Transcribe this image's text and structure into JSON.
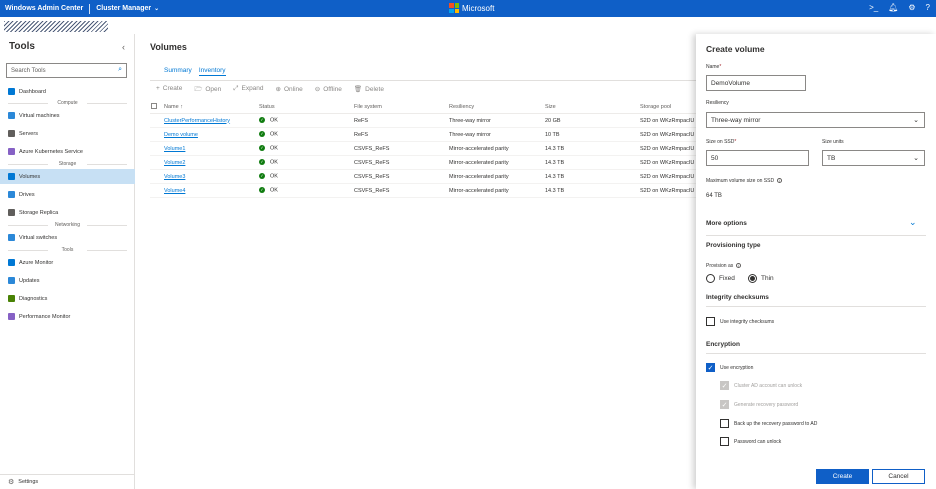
{
  "topbar": {
    "app_title": "Windows Admin Center",
    "context": "Cluster Manager",
    "brand": "Microsoft"
  },
  "colors": {
    "accent": "#0f5fc7",
    "link": "#0078d4",
    "ok": "#107c10",
    "selected": "#c7e0f4"
  },
  "sidebar": {
    "title": "Tools",
    "search_placeholder": "Search Tools",
    "items": {
      "dashboard": "Dashboard",
      "compute_group": "Compute",
      "virtual_machines": "Virtual machines",
      "servers": "Servers",
      "aks": "Azure Kubernetes Service",
      "storage_group": "Storage",
      "volumes": "Volumes",
      "drives": "Drives",
      "storage_replica": "Storage Replica",
      "networking_group": "Networking",
      "virtual_switches": "Virtual switches",
      "tools_group": "Tools",
      "azure_monitor": "Azure Monitor",
      "updates": "Updates",
      "diagnostics": "Diagnostics",
      "performance_monitor": "Performance Monitor"
    },
    "settings": "Settings"
  },
  "main": {
    "title": "Volumes",
    "tabs": [
      "Summary",
      "Inventory"
    ],
    "toolbar": [
      "Create",
      "Open",
      "Expand",
      "Online",
      "Offline",
      "Delete"
    ],
    "columns": [
      "Name",
      "Status",
      "File system",
      "Resiliency",
      "Size",
      "Storage pool"
    ],
    "name_sort_indicator": "↑",
    "rows": [
      {
        "name": "ClusterPerformanceHistory",
        "status": "OK",
        "fs": "ReFS",
        "resiliency": "Three-way mirror",
        "size": "20 GB",
        "pool": "S2D on WKzRmpacIU"
      },
      {
        "name": "Demo volume",
        "status": "OK",
        "fs": "ReFS",
        "resiliency": "Three-way mirror",
        "size": "10 TB",
        "pool": "S2D on WKzRmpacIU"
      },
      {
        "name": "Volume1",
        "status": "OK",
        "fs": "CSVFS_ReFS",
        "resiliency": "Mirror-accelerated parity",
        "size": "14.3 TB",
        "pool": "S2D on WKzRmpacIU"
      },
      {
        "name": "Volume2",
        "status": "OK",
        "fs": "CSVFS_ReFS",
        "resiliency": "Mirror-accelerated parity",
        "size": "14.3 TB",
        "pool": "S2D on WKzRmpacIU"
      },
      {
        "name": "Volume3",
        "status": "OK",
        "fs": "CSVFS_ReFS",
        "resiliency": "Mirror-accelerated parity",
        "size": "14.3 TB",
        "pool": "S2D on WKzRmpacIU"
      },
      {
        "name": "Volume4",
        "status": "OK",
        "fs": "CSVFS_ReFS",
        "resiliency": "Mirror-accelerated parity",
        "size": "14.3 TB",
        "pool": "S2D on WKzRmpacIU"
      }
    ]
  },
  "panel": {
    "title": "Create volume",
    "name_label": "Name",
    "name_value": "DemoVolume",
    "resiliency_label": "Resiliency",
    "resiliency_value": "Three-way mirror",
    "size_label": "Size on SSD",
    "size_value": "50",
    "units_label": "Size units",
    "units_value": "TB",
    "max_label": "Maximum volume size on SSD",
    "max_value": "64 TB",
    "more_options": "More options",
    "provisioning_title": "Provisioning type",
    "provision_as": "Provision as",
    "fixed": "Fixed",
    "thin": "Thin",
    "integrity_title": "Integrity checksums",
    "use_integrity": "Use integrity checksums",
    "encryption_title": "Encryption",
    "use_encryption": "Use encryption",
    "cluster_ad": "Cluster AD account can unlock",
    "gen_password": "Generate recovery password",
    "backup_ad": "Back up the recovery password to AD",
    "password_unlock": "Password can unlock",
    "create": "Create",
    "cancel": "Cancel"
  }
}
